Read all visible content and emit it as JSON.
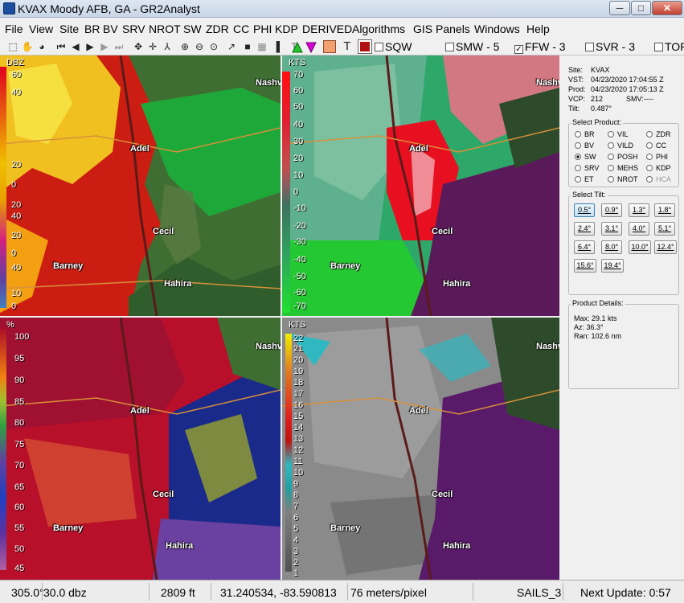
{
  "window": {
    "title": "KVAX Moody AFB, GA - GR2Analyst",
    "minimize": "─",
    "maximize": "□",
    "close": "✕"
  },
  "menu": [
    "File",
    "View",
    "Site",
    "BR",
    "BV",
    "SRV",
    "NROT",
    "SW",
    "ZDR",
    "CC",
    "PHI",
    "KDP",
    "DERIVED",
    "Algorithms",
    "GIS",
    "Panels",
    "Windows",
    "Help"
  ],
  "toolbar": {
    "icons": [
      "select-icon",
      "pan-icon",
      "globe-icon",
      "first-frame-icon",
      "prev-frame-icon",
      "play-icon",
      "next-frame-icon",
      "last-frame-icon",
      "move-icon",
      "cross-section-icon",
      "tools-icon",
      "zoom-in-icon",
      "zoom-out-icon",
      "zoom-reset-icon",
      "pointer-icon",
      "stop-icon",
      "grid-icon",
      "color-icon",
      "text-icon",
      "storm-motion-icon",
      "tvs-icon",
      "meso-icon"
    ],
    "sqw": "SQW",
    "smw": "SMW - 5",
    "ffw": "FFW - 3",
    "svr": "SVR - 3",
    "tor": "TOR",
    "colors": {
      "green_triangle": "#22c42a",
      "magenta_triangle": "#d400d4",
      "orange_square": "#f2a070",
      "red_square": "#b01010"
    }
  },
  "panes": {
    "reflectivity": {
      "unit": "DBZ",
      "scale": [
        "60",
        "40",
        "20",
        "0",
        "20",
        "40",
        "20",
        "0",
        "40",
        "10",
        "0"
      ]
    },
    "velocity": {
      "unit": "KTS",
      "scale": [
        "70",
        "60",
        "50",
        "40",
        "30",
        "20",
        "10",
        "0",
        "-10",
        "-20",
        "-30",
        "-40",
        "-50",
        "-60",
        "-70"
      ]
    },
    "correlation": {
      "unit": "%",
      "scale": [
        "100",
        "95",
        "90",
        "85",
        "80",
        "75",
        "70",
        "65",
        "60",
        "55",
        "50",
        "45"
      ]
    },
    "spectrum": {
      "unit": "KTS",
      "scale": [
        "22",
        "21",
        "20",
        "19",
        "18",
        "17",
        "16",
        "15",
        "14",
        "13",
        "12",
        "11",
        "10",
        "9",
        "8",
        "7",
        "6",
        "5",
        "4",
        "3",
        "2",
        "1"
      ]
    },
    "cities": [
      "Nashv",
      "Adel",
      "Cecil",
      "Barney",
      "Hahira"
    ]
  },
  "side": {
    "site": "Site:",
    "site_val": "KVAX",
    "vst": "VST:",
    "vst_val": "04/23/2020  17:04:55 Z",
    "prod": "Prod:",
    "prod_val": "04/23/2020  17:05:13 Z",
    "vcp": "VCP:",
    "vcp_val": "212",
    "smv": "SMV:",
    "smv_val": "----",
    "tilt": "Tilt:",
    "tilt_val": "0.487°",
    "select_product": "Select Product:",
    "products": [
      "BR",
      "VIL",
      "ZDR",
      "BV",
      "VILD",
      "CC",
      "SW",
      "POSH",
      "PHI",
      "SRV",
      "MEHS",
      "KDP",
      "ET",
      "NROT",
      "HCA"
    ],
    "selected_product": "SW",
    "select_tilt": "Select Tilt:",
    "tilts": [
      "0.5°",
      "0.9°",
      "1.3°",
      "1.8°",
      "2.4°",
      "3.1°",
      "4.0°",
      "5.1°",
      "6.4°",
      "8.0°",
      "10.0°",
      "12.4°",
      "15.6°",
      "19.4°"
    ],
    "product_details": "Product Details:",
    "details": [
      "Max:  29.1 kts",
      "Az:  36.3°",
      "Ran:  102.6 nm"
    ]
  },
  "status": {
    "az": "305.0°",
    "val": "30.0 dbz",
    "height": "2809 ft",
    "coords": "31.240534, -83.590813",
    "res": "76 meters/pixel",
    "mode": "SAILS_3",
    "next": "Next Update: 0:57"
  }
}
